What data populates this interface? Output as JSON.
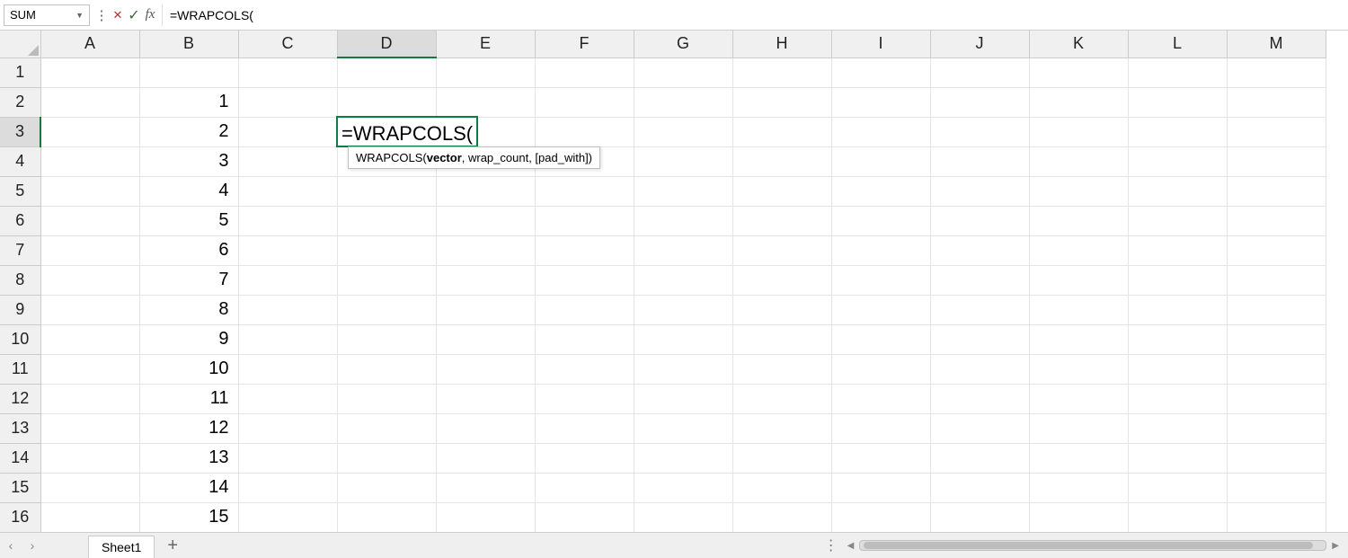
{
  "formula_bar": {
    "name_box_value": "SUM",
    "formula_text": "=WRAPCOLS("
  },
  "editing": {
    "cell_ref": "D3",
    "display_text": "=WRAPCOLS(",
    "tooltip_fn": "WRAPCOLS(",
    "tooltip_bold_arg": "vector",
    "tooltip_rest_args": ", wrap_count, [pad_with])"
  },
  "columns": [
    "A",
    "B",
    "C",
    "D",
    "E",
    "F",
    "G",
    "H",
    "I",
    "J",
    "K",
    "L",
    "M"
  ],
  "rows": [
    "1",
    "2",
    "3",
    "4",
    "5",
    "6",
    "7",
    "8",
    "9",
    "10",
    "11",
    "12",
    "13",
    "14",
    "15",
    "16"
  ],
  "active_col": "D",
  "active_row": "3",
  "cells": {
    "B2": "1",
    "B3": "2",
    "B4": "3",
    "B5": "4",
    "B6": "5",
    "B7": "6",
    "B8": "7",
    "B9": "8",
    "B10": "9",
    "B11": "10",
    "B12": "11",
    "B13": "12",
    "B14": "13",
    "B15": "14",
    "B16": "15"
  },
  "sheet_tab": "Sheet1"
}
